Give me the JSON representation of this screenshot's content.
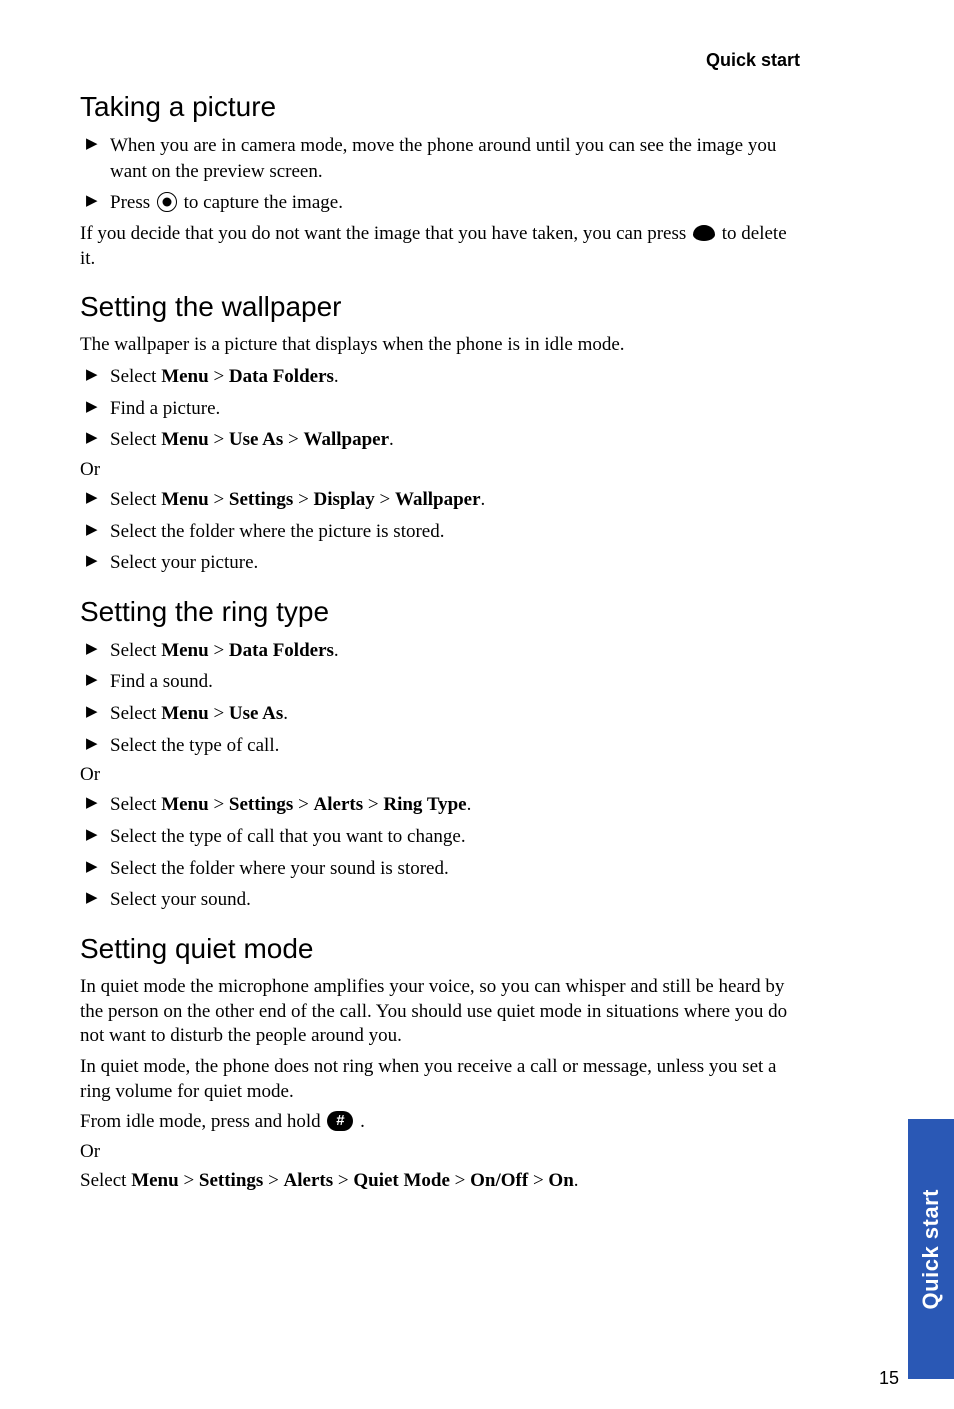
{
  "header": {
    "title": "Quick start"
  },
  "sidebar": {
    "label": "Quick start"
  },
  "page_number": "15",
  "sections": {
    "s1": {
      "heading": "Taking a picture",
      "bullet1": "When you are in camera mode, move the phone around until you can see the image you want on the preview screen.",
      "bullet2_a": "Press ",
      "bullet2_b": "  to capture the image.",
      "body_a": "If you decide that you do not want the image that you have taken, you can press ",
      "body_b": " to delete it."
    },
    "s2": {
      "heading": "Setting the wallpaper",
      "intro": "The wallpaper is a picture that displays when the phone is in idle mode.",
      "b1_a": "Select ",
      "b1_menu": "Menu",
      "b1_gt": " > ",
      "b1_df": "Data Folders",
      "b1_end": ".",
      "b2": "Find a picture.",
      "b3_a": "Select ",
      "b3_menu": "Menu",
      "b3_useas": "Use As",
      "b3_wp": "Wallpaper",
      "or": "Or",
      "b4_settings": "Settings",
      "b4_display": "Display",
      "b5": "Select the folder where the picture is stored.",
      "b6": "Select your picture."
    },
    "s3": {
      "heading": "Setting the ring type",
      "b1_a": "Select ",
      "menu": "Menu",
      "gt": " > ",
      "df": "Data Folders",
      "end": ".",
      "b2": "Find a sound.",
      "useas": "Use As",
      "b4": "Select the type of call.",
      "or": "Or",
      "settings": "Settings",
      "alerts": "Alerts",
      "ringtype": "Ring Type",
      "b5": "Select the type of call that you want to change.",
      "b6": "Select the folder where your sound is stored.",
      "b7": "Select your sound."
    },
    "s4": {
      "heading": "Setting quiet mode",
      "p1": "In quiet mode the microphone amplifies your voice, so you can whisper and still be heard by the person on the other end of the call. You should use quiet mode in situations where you do not want to disturb the people around you.",
      "p2": "In quiet mode, the phone does not ring when you receive a call or message, unless you set a ring volume for quiet mode.",
      "p3_a": "From idle mode, press and hold ",
      "p3_b": " .",
      "or": "Or",
      "p4_a": "Select ",
      "menu": "Menu",
      "gt": " > ",
      "settings": "Settings",
      "alerts": "Alerts",
      "qm": "Quiet Mode",
      "onoff": "On/Off",
      "on": "On",
      "end": "."
    }
  }
}
